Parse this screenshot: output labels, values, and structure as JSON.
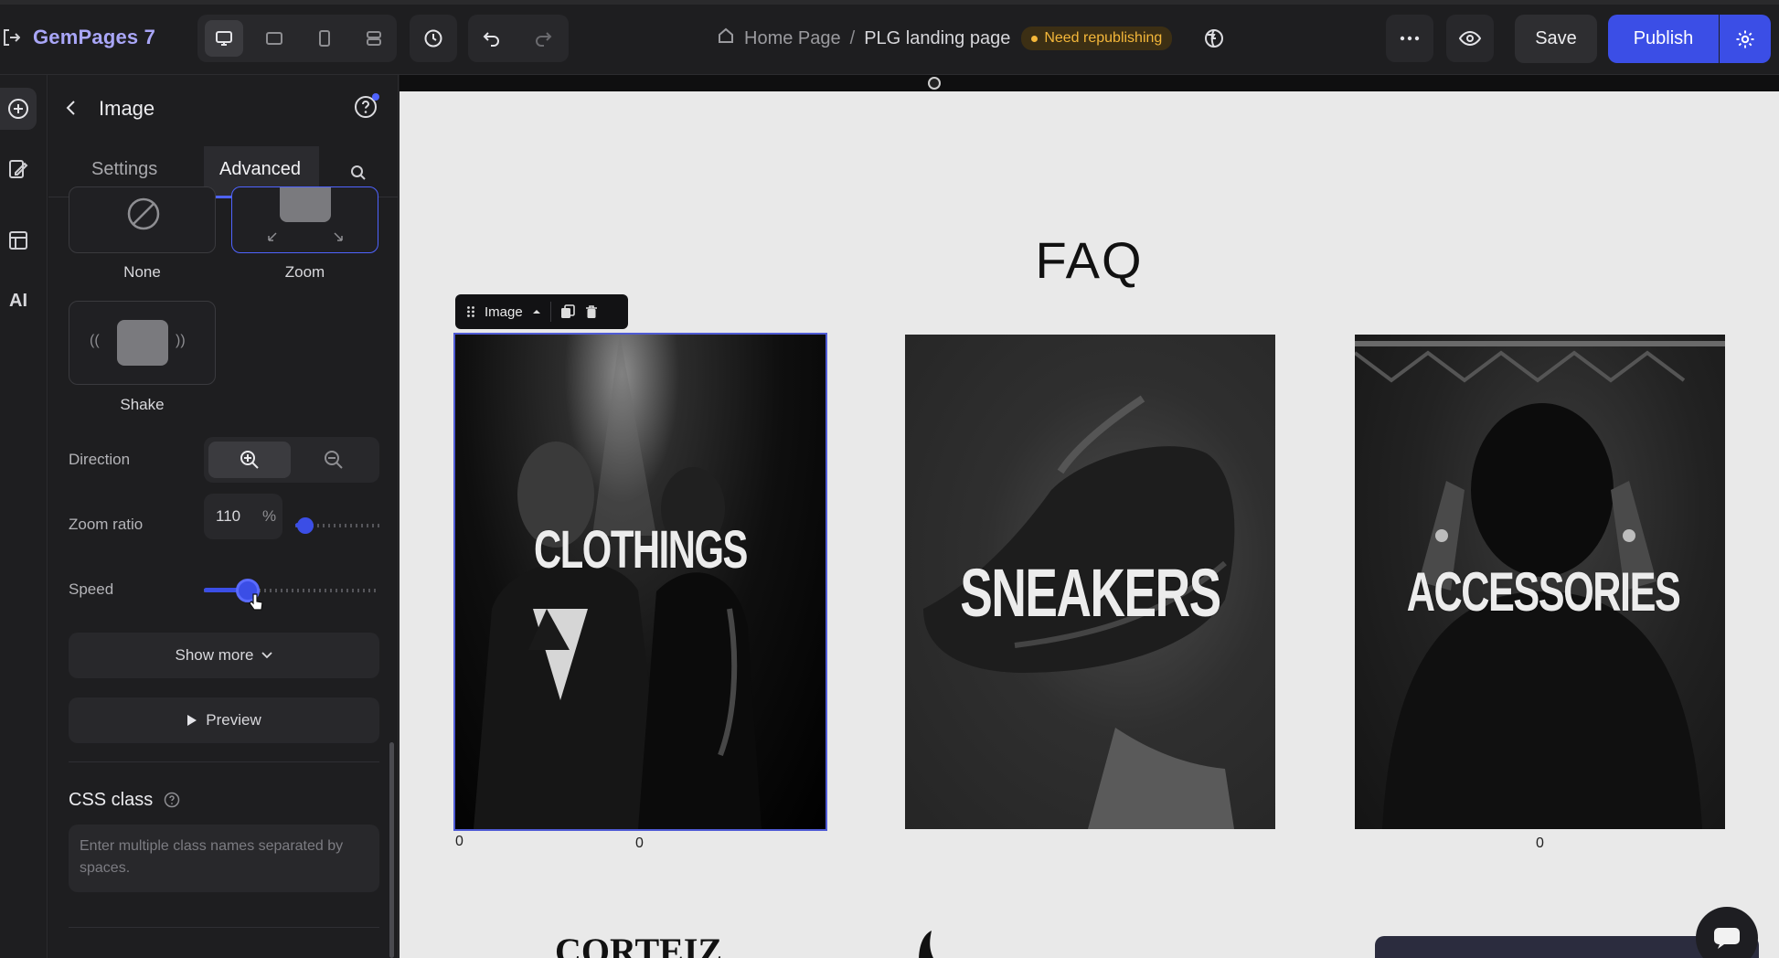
{
  "app": {
    "brand": "GemPages 7",
    "icons": {
      "exit": "exit-icon",
      "desktop": "desktop-icon",
      "tablet": "tablet-icon",
      "mobile": "mobile-icon",
      "layers": "layers-icon",
      "history": "history-icon",
      "undo": "undo-icon",
      "redo": "redo-icon",
      "home": "home-icon",
      "language": "language-icon",
      "more": "more-icon",
      "preview": "eye-icon",
      "settings": "gear-icon"
    }
  },
  "breadcrumb": {
    "home": "Home Page",
    "separator": "/",
    "page": "PLG landing page",
    "status": "Need republishing"
  },
  "actions": {
    "save": "Save",
    "publish": "Publish"
  },
  "rail": {
    "items": [
      "add-element-icon",
      "design-icon",
      "layout-icon"
    ],
    "ai_label": "AI"
  },
  "panel": {
    "title": "Image",
    "tabs": [
      "Settings",
      "Advanced"
    ],
    "active_tab": "Advanced",
    "animations": [
      {
        "label": "None",
        "selected": false
      },
      {
        "label": "Zoom",
        "selected": true
      },
      {
        "label": "Shake",
        "selected": false
      }
    ],
    "direction": {
      "label": "Direction",
      "options": [
        "zoom-in-icon",
        "zoom-out-icon"
      ],
      "selected": "zoom-in-icon"
    },
    "zoom_ratio": {
      "label": "Zoom ratio",
      "value": "110",
      "unit": "%",
      "slider_fraction": 0.12
    },
    "speed": {
      "label": "Speed",
      "slider_fraction": 0.25
    },
    "show_more": "Show more",
    "preview": "Preview",
    "css_class": {
      "title": "CSS class",
      "placeholder": "Enter multiple class names separated by spaces."
    }
  },
  "canvas": {
    "heading": "FAQ",
    "selected_element_label": "Image",
    "cards": [
      {
        "text": "CLOTHINGS",
        "caption": "0"
      },
      {
        "text": "SNEAKERS",
        "caption": ""
      },
      {
        "text": "ACCESSORIES",
        "caption": "0"
      }
    ],
    "left_zero": "0",
    "bottom_partial": [
      "CORTEIZ"
    ],
    "colors": {
      "accent": "#3b4ee6",
      "warning": "#f4b73a",
      "canvas_bg": "#e9e9e9"
    }
  }
}
